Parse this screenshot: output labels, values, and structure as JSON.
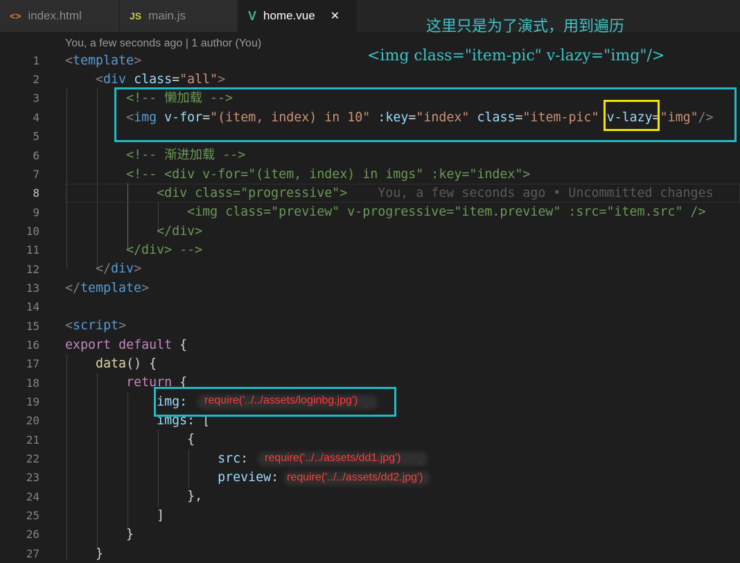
{
  "tabs": [
    {
      "icon": "<>",
      "label": "index.html"
    },
    {
      "icon": "JS",
      "label": "main.js"
    },
    {
      "icon": "V",
      "label": "home.vue",
      "close": "✕"
    }
  ],
  "annotation": {
    "title": "这里只是为了演式，用到遍历",
    "code": "<img class=\"item-pic\" v-lazy=\"img\"/>"
  },
  "blame_header": "You, a few seconds ago | 1 author (You)",
  "inline_blame": "You, a few seconds ago • Uncommitted changes",
  "line_numbers": [
    "1",
    "2",
    "3",
    "4",
    "5",
    "6",
    "7",
    "8",
    "9",
    "10",
    "11",
    "12",
    "13",
    "14",
    "15",
    "16",
    "17",
    "18",
    "19",
    "20",
    "21",
    "22",
    "23",
    "24",
    "25",
    "26",
    "27"
  ],
  "redacted": {
    "img": "require('../../assets/loginbg.jpg')",
    "src": "require('../../assets/dd1.jpg')",
    "preview": "require('../../assets/dd2.jpg')"
  },
  "colors": {
    "annotation": "#3fc4c6",
    "highlight_box": "#1fbac6",
    "focus_box": "#f2e400",
    "redacted_text": "#ff3b3b"
  }
}
